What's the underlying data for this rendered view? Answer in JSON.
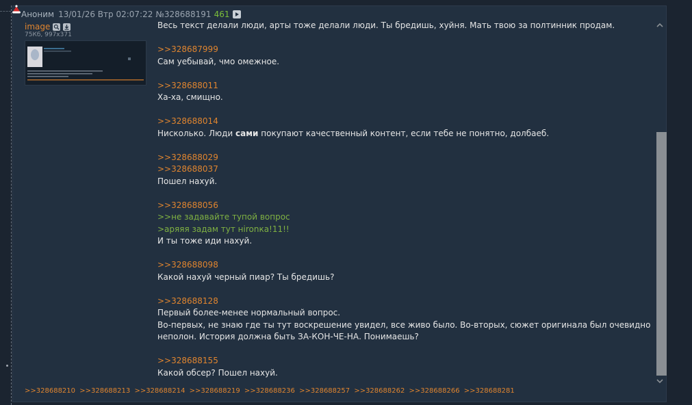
{
  "post": {
    "poster_name": "Аноним",
    "date": "13/01/26 Втр 02:07:22",
    "number": "№328688191",
    "reply_count": "461",
    "file": {
      "name": "image",
      "meta": "75Кб, 997x371"
    },
    "body": {
      "p1": "Весь текст делали люди, арты тоже делали люди. Ты бредишь, хуйня. Мать твою за полтинник продам.",
      "p2_ref": ">>328687999",
      "p2_text": "Сам уебывай, чмо омежное.",
      "p3_ref": ">>328688011",
      "p3_text": "Ха-ха, смищно.",
      "p4_ref": ">>328688014",
      "p4_text_a": "Нисколько. Люди ",
      "p4_text_bold": "сами",
      "p4_text_b": " покупают качественный контент, если тебе не понятно, долбаеб.",
      "p5_ref1": ">>328688029",
      "p5_ref2": ">>328688037",
      "p5_text": "Пошел нахуй.",
      "p6_ref": ">>328688056",
      "p6_quote1": ">>не задавайте тупой вопрос",
      "p6_quote2": ">аряяя задам тут нironка!11!!",
      "p6_text": "И ты тоже иди нахуй.",
      "p7_ref": ">>328688098",
      "p7_text": "Какой нахуй черный пиар? Ты бредишь?",
      "p8_ref": ">>328688128",
      "p8_text1": "Первый более-менее нормальный вопрос.",
      "p8_text2": "Во-первых, не знаю где ты тут воскрешение увидел, все живо было. Во-вторых, сюжет оригинала был очевидно неполон. История должна быть ЗА-КОН-ЧЕ-НА. Понимаешь?",
      "p9_ref": ">>328688155",
      "p9_text": "Какой обсер? Пошел нахуй."
    },
    "backlinks": [
      ">>328688210",
      ">>328688213",
      ">>328688214",
      ">>328688219",
      ">>328688236",
      ">>328688257",
      ">>328688262",
      ">>328688266",
      ">>328688281"
    ]
  },
  "icons": [
    "santa-hat-icon",
    "play-icon",
    "magnify-icon",
    "download-icon",
    "chevron-up-icon",
    "chevron-down-icon"
  ],
  "colors": {
    "background": "#1b2430",
    "post": "#223040",
    "link": "#e0852f",
    "quote": "#7fb142",
    "text": "#e6e6e6"
  }
}
